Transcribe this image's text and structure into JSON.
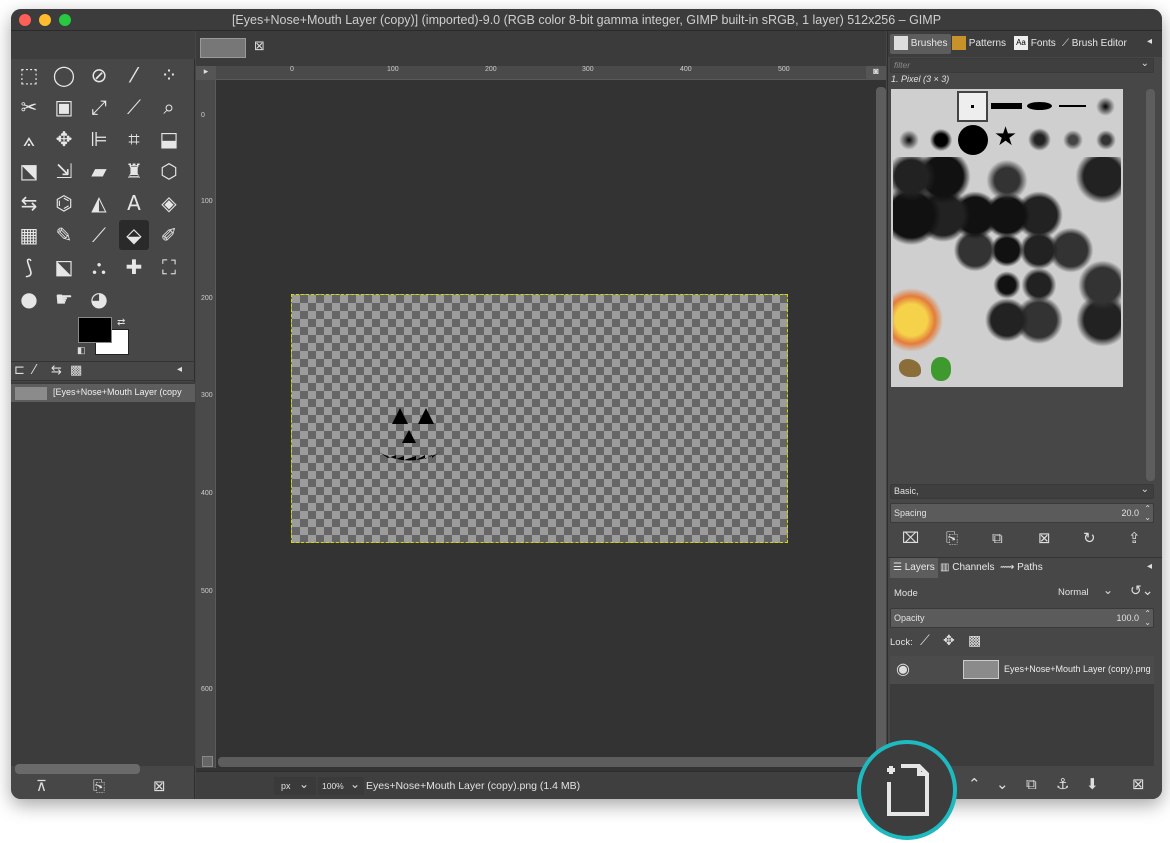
{
  "window": {
    "title": "[Eyes+Nose+Mouth Layer (copy)] (imported)-9.0 (RGB color 8-bit gamma integer, GIMP built-in sRGB, 1 layer) 512x256 – GIMP"
  },
  "images_panel": {
    "layer_name": "[Eyes+Nose+Mouth Layer (copy"
  },
  "rulers": {
    "h_marks": [
      "0",
      "100",
      "200",
      "300",
      "400",
      "500"
    ],
    "v_marks": [
      "0",
      "100",
      "200",
      "300",
      "400",
      "500",
      "600"
    ]
  },
  "brushes": {
    "tabs": [
      "Brushes",
      "Patterns",
      "Fonts",
      "Brush Editor"
    ],
    "filter_placeholder": "filter",
    "selected_brush": "1. Pixel (3 × 3)",
    "preset": "Basic,",
    "spacing_label": "Spacing",
    "spacing_value": "20.0"
  },
  "layers": {
    "tabs": [
      "Layers",
      "Channels",
      "Paths"
    ],
    "mode_label": "Mode",
    "mode_value": "Normal",
    "opacity_label": "Opacity",
    "opacity_value": "100.0",
    "lock_label": "Lock:",
    "layer_name": "Eyes+Nose+Mouth Layer (copy).png"
  },
  "statusbar": {
    "unit": "px",
    "zoom": "100%",
    "info": "Eyes+Nose+Mouth Layer (copy).png (1.4 MB)"
  },
  "colors": {
    "highlight_ring": "#1fb9c0",
    "selection_dash": "#d8d800"
  }
}
